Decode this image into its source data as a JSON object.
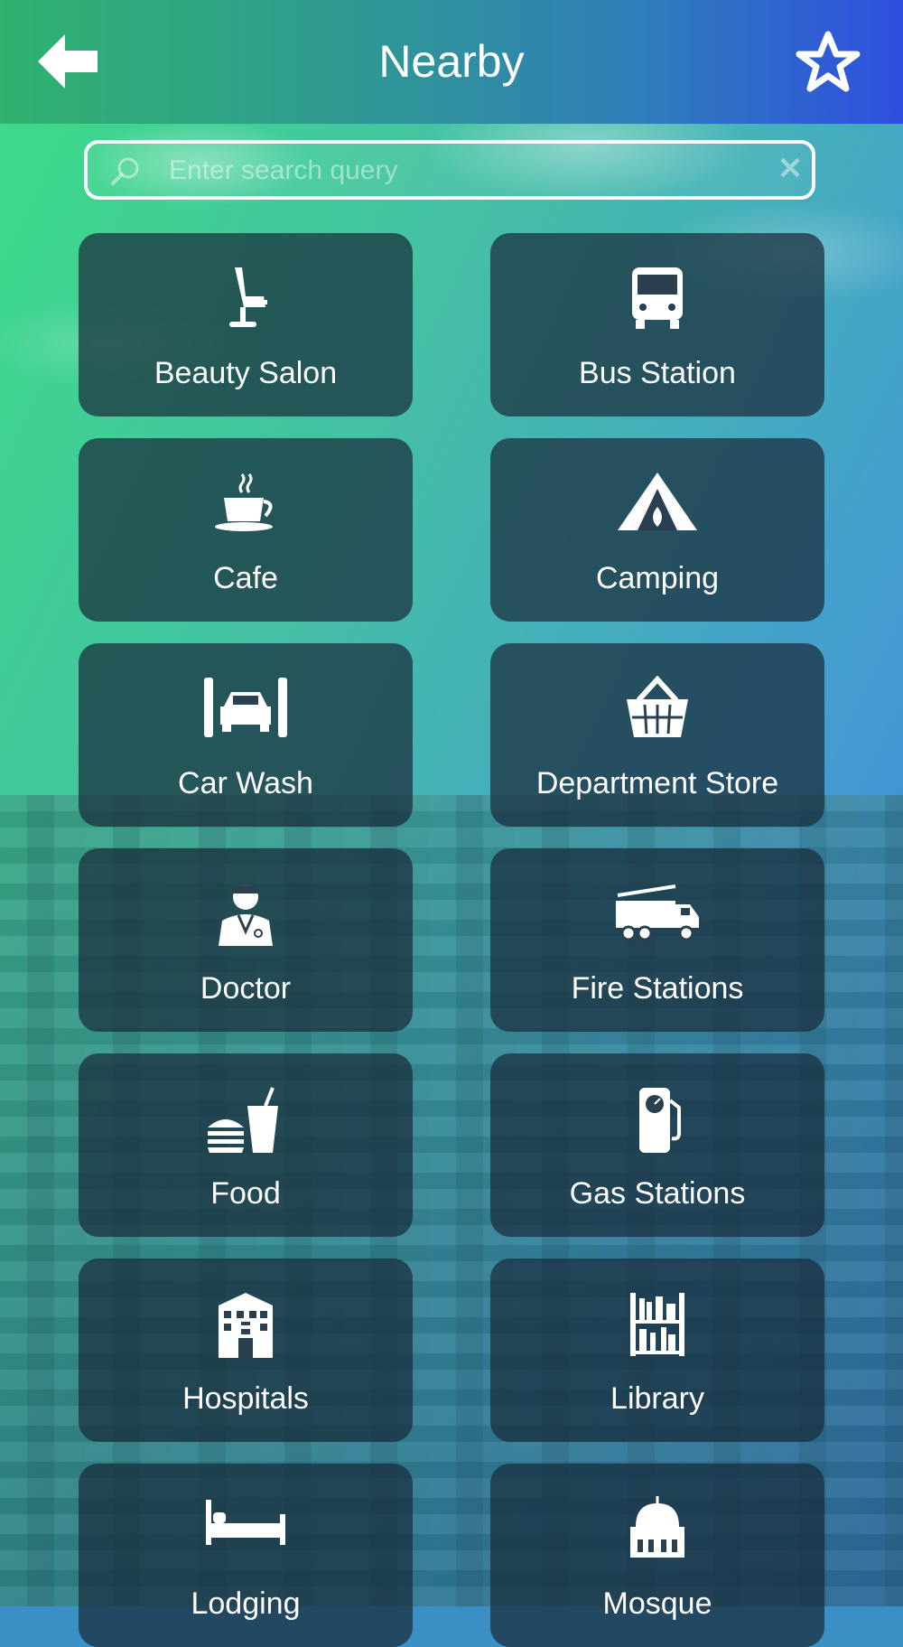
{
  "header": {
    "title": "Nearby",
    "back_icon": "arrow-left-icon",
    "favorite_icon": "star-outline-icon"
  },
  "search": {
    "placeholder": "Enter search query",
    "value": "",
    "search_icon": "magnifier-icon",
    "clear_icon": "clear-x-icon"
  },
  "categories": [
    {
      "label": "Beauty Salon",
      "icon": "salon-chair-icon"
    },
    {
      "label": "Bus Station",
      "icon": "bus-icon"
    },
    {
      "label": "Cafe",
      "icon": "coffee-cup-icon"
    },
    {
      "label": "Camping",
      "icon": "tent-icon"
    },
    {
      "label": "Car Wash",
      "icon": "car-wash-icon"
    },
    {
      "label": "Department Store",
      "icon": "shopping-basket-icon"
    },
    {
      "label": "Doctor",
      "icon": "doctor-icon"
    },
    {
      "label": "Fire Stations",
      "icon": "fire-truck-icon"
    },
    {
      "label": "Food",
      "icon": "burger-drink-icon"
    },
    {
      "label": "Gas Stations",
      "icon": "fuel-pump-icon"
    },
    {
      "label": "Hospitals",
      "icon": "hospital-icon"
    },
    {
      "label": "Library",
      "icon": "bookshelf-icon"
    },
    {
      "label": "Lodging",
      "icon": "bed-icon"
    },
    {
      "label": "Mosque",
      "icon": "mosque-icon"
    }
  ],
  "colors": {
    "header_start": "#2fb36f",
    "header_end": "#2f4fe0",
    "tile_bg": "#19303c",
    "text": "#ffffff"
  }
}
